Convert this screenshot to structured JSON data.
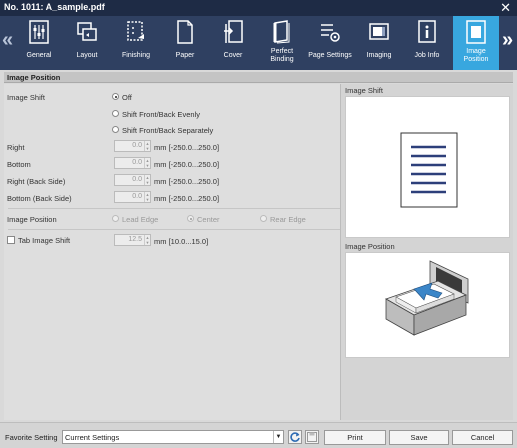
{
  "window": {
    "title": "No. 1011: A_sample.pdf",
    "close_icon": "close-icon"
  },
  "toolbar": {
    "tabs": [
      {
        "label": "General",
        "icon": "general-icon"
      },
      {
        "label": "Layout",
        "icon": "layout-icon"
      },
      {
        "label": "Finishing",
        "icon": "finishing-icon"
      },
      {
        "label": "Paper",
        "icon": "paper-icon"
      },
      {
        "label": "Cover",
        "icon": "cover-icon"
      },
      {
        "label": "Perfect Binding",
        "icon": "perfect-binding-icon"
      },
      {
        "label": "Page Settings",
        "icon": "page-settings-icon"
      },
      {
        "label": "Imaging",
        "icon": "imaging-icon"
      },
      {
        "label": "Job Info",
        "icon": "job-info-icon"
      },
      {
        "label": "Image Position",
        "icon": "image-position-icon",
        "active": true
      }
    ],
    "active_color": "#38a7df"
  },
  "section": {
    "title": "Image Position"
  },
  "image_shift": {
    "label": "Image Shift",
    "options": [
      "Off",
      "Shift Front/Back Evenly",
      "Shift Front/Back Separately"
    ],
    "selected": "Off"
  },
  "fields": [
    {
      "label": "Right",
      "value": "0.0",
      "unit": "mm [-250.0...250.0]"
    },
    {
      "label": "Bottom",
      "value": "0.0",
      "unit": "mm [-250.0...250.0]"
    },
    {
      "label": "Right (Back Side)",
      "value": "0.0",
      "unit": "mm [-250.0...250.0]"
    },
    {
      "label": "Bottom (Back Side)",
      "value": "0.0",
      "unit": "mm [-250.0...250.0]"
    }
  ],
  "image_position": {
    "label": "Image Position",
    "options": [
      "Lead Edge",
      "Center",
      "Rear Edge"
    ],
    "selected": "Center"
  },
  "tab_shift": {
    "label": "Tab Image Shift",
    "value": "12.5",
    "unit": "mm [10.0...15.0]",
    "checked": false
  },
  "preview": {
    "shift_title": "Image Shift",
    "position_title": "Image Position"
  },
  "footer": {
    "favorite_label": "Favorite Setting",
    "favorite_value": "Current Settings",
    "print": "Print",
    "save": "Save",
    "cancel": "Cancel"
  }
}
